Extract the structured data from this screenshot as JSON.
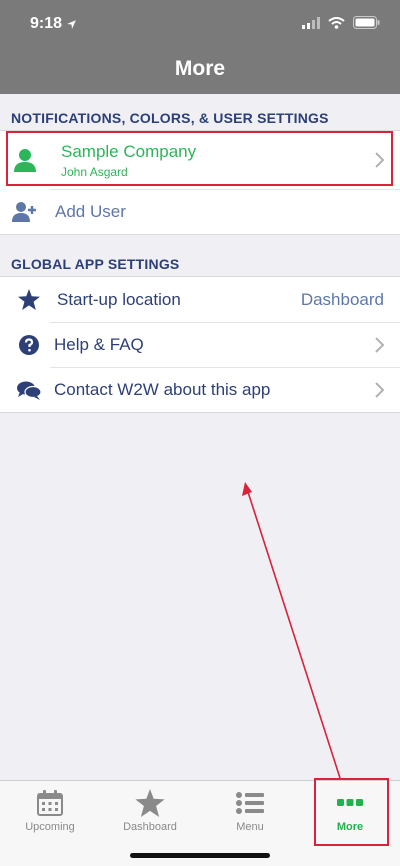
{
  "status": {
    "time": "9:18"
  },
  "nav": {
    "title": "More"
  },
  "section1": {
    "header": "NOTIFICATIONS, COLORS, & USER SETTINGS",
    "company": {
      "name": "Sample Company",
      "user": "John Asgard"
    },
    "add_user": "Add User"
  },
  "section2": {
    "header": "GLOBAL APP SETTINGS",
    "startup": {
      "label": "Start-up location",
      "value": "Dashboard"
    },
    "help": {
      "label": "Help & FAQ"
    },
    "contact": {
      "label": "Contact W2W about this app"
    }
  },
  "tabs": [
    {
      "label": "Upcoming",
      "icon": "calendar-icon"
    },
    {
      "label": "Dashboard",
      "icon": "star-icon"
    },
    {
      "label": "Menu",
      "icon": "list-icon"
    },
    {
      "label": "More",
      "icon": "dots-icon"
    }
  ],
  "colors": {
    "accent": "#2bb65a",
    "text": "#2d3f77",
    "highlight": "#d8233a"
  }
}
